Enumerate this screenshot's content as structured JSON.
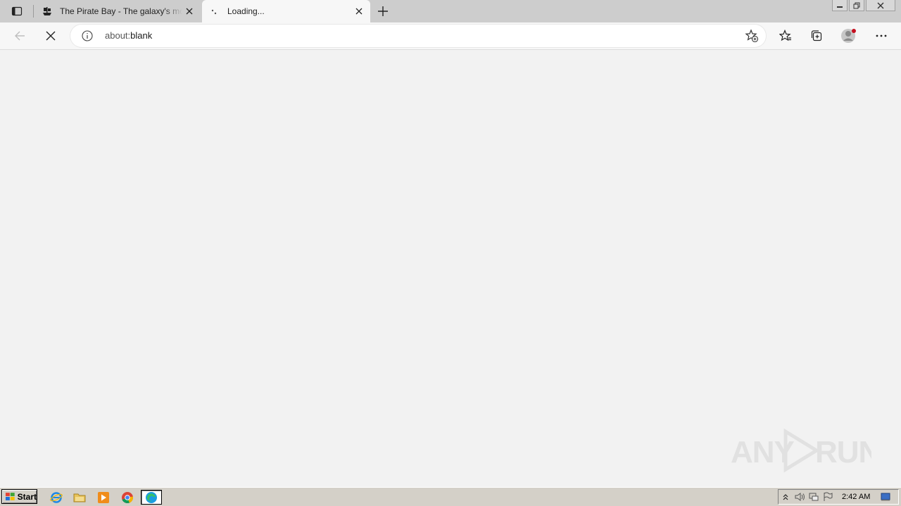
{
  "browser": {
    "tabs": [
      {
        "title": "The Pirate Bay - The galaxy's most resilient BitTorrent site",
        "icon": "pirate-ship-icon",
        "active": false
      },
      {
        "title": "Loading...",
        "icon": "loading-spinner-icon",
        "active": true
      }
    ],
    "address": {
      "prefix": "about:",
      "rest": "blank"
    }
  },
  "watermark": {
    "text": "ANY RUN"
  },
  "taskbar": {
    "start_label": "Start",
    "clock": "2:42 AM",
    "quick_launch": [
      "internet-explorer-icon",
      "folder-icon",
      "media-player-icon",
      "chrome-icon",
      "edge-icon"
    ]
  },
  "colors": {
    "accent_profile_badge": "#c50f1f",
    "tabbar": "#cdcdcd",
    "toolbar": "#f7f7f7"
  }
}
